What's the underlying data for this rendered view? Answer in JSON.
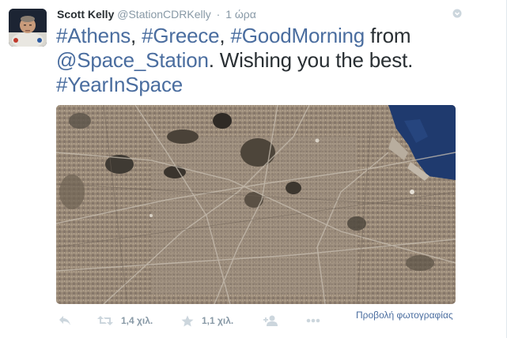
{
  "author": {
    "name": "Scott Kelly",
    "handle": "@StationCDRKelly",
    "separator": "·",
    "time": "1 ώρα"
  },
  "tweet": {
    "line1": [
      {
        "text": "#Athens",
        "link": true
      },
      {
        "text": ", ",
        "link": false
      },
      {
        "text": "#Greece",
        "link": true
      },
      {
        "text": ", ",
        "link": false
      },
      {
        "text": "#GoodMorning",
        "link": true
      },
      {
        "text": " from",
        "link": false
      }
    ],
    "line2": [
      {
        "text": "@Space_Station",
        "link": true
      },
      {
        "text": ". Wishing you the best.",
        "link": false
      }
    ],
    "line3": [
      {
        "text": "#YearInSpace",
        "link": true
      }
    ]
  },
  "actions": {
    "reply_icon": "reply-icon",
    "retweet_icon": "retweet-icon",
    "retweet_count": "1,4 χιλ.",
    "favorite_icon": "star-icon",
    "favorite_count": "1,1 χιλ.",
    "follow_icon": "follow-icon",
    "more_icon": "more-icon",
    "view_photo": "Προβολή φωτογραφίας"
  },
  "colors": {
    "link": "#4a6d9f",
    "text": "#292f33",
    "muted": "#8899a6",
    "sea": "#1f3a6e"
  }
}
